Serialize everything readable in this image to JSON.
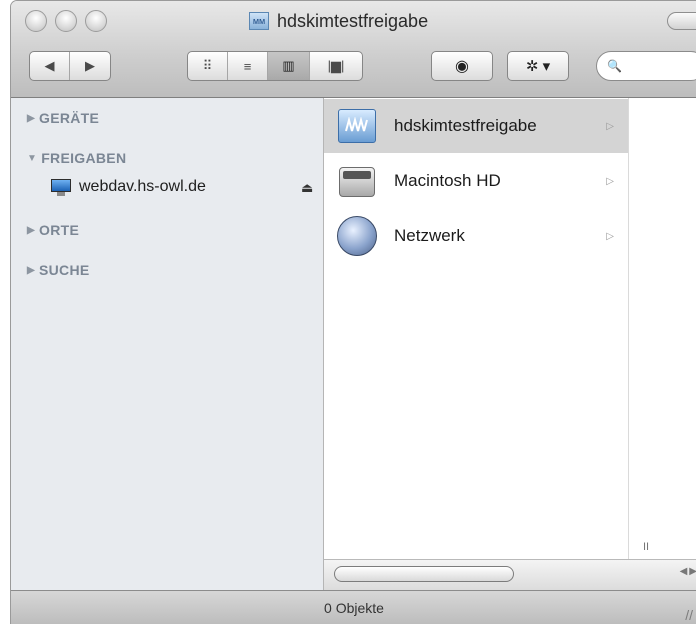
{
  "window": {
    "title": "hdskimtestfreigabe"
  },
  "toolbar": {
    "back_glyph": "◀",
    "forward_glyph": "▶",
    "views": [
      {
        "name": "icon-view",
        "glyph": "⠿"
      },
      {
        "name": "list-view",
        "glyph": "≡"
      },
      {
        "name": "column-view",
        "glyph": "▥",
        "selected": true
      },
      {
        "name": "coverflow-view",
        "glyph": "|▆|"
      }
    ],
    "quicklook_glyph": "◉",
    "action_glyph": "✲ ▾",
    "search_glyph": "🔍"
  },
  "sidebar": {
    "groups": [
      {
        "label": "GERÄTE",
        "expanded": false
      },
      {
        "label": "FREIGABEN",
        "expanded": true
      },
      {
        "label": "ORTE",
        "expanded": false
      },
      {
        "label": "SUCHE",
        "expanded": false
      }
    ],
    "shares": [
      {
        "label": "webdav.hs-owl.de",
        "icon": "monitor-icon",
        "eject_glyph": "⏏"
      }
    ]
  },
  "browser": {
    "column1": [
      {
        "label": "hdskimtestfreigabe",
        "icon": "network-share-icon",
        "selected": true,
        "arrow_glyph": "▷"
      },
      {
        "label": "Macintosh HD",
        "icon": "hard-disk-icon",
        "selected": false,
        "arrow_glyph": "▷"
      },
      {
        "label": "Netzwerk",
        "icon": "network-globe-icon",
        "selected": false,
        "arrow_glyph": "▷"
      }
    ]
  },
  "statusbar": {
    "text": "0 Objekte"
  },
  "colors": {
    "selection": "#d4d4d4",
    "sidebar_bg": "#e8ebef",
    "group_label": "#7b8694"
  }
}
